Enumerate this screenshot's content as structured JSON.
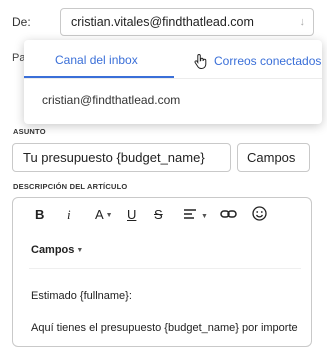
{
  "form": {
    "from_label": "De:",
    "from_value": "cristian.vitales@findthatlead.com",
    "hidden_label_fragment": "Pa"
  },
  "dropdown": {
    "tabs": [
      {
        "label": "Canal del inbox",
        "active": true
      },
      {
        "label": "Correos conectados",
        "active": false
      }
    ],
    "options": [
      "cristian@findthatlead.com"
    ]
  },
  "subject": {
    "label": "ASUNTO",
    "value": "Tu presupuesto {budget_name}",
    "fields_button": "Campos"
  },
  "description": {
    "label": "DESCRIPCIÓN DEL ARTÍCULO",
    "fields_dropdown": "Campos",
    "body_lines": [
      "Estimado {fullname}:",
      "Aquí tienes el presupuesto {budget_name} por importe"
    ]
  },
  "toolbar": {
    "bold": "B",
    "italic": "i",
    "font": "A",
    "underline": "U",
    "strikethrough": "S"
  },
  "colors": {
    "accent": "#3a6fd8",
    "border": "#c9c9c9"
  },
  "icons": [
    "chevron-down-icon",
    "hand-cursor-icon",
    "align-icon",
    "link-icon",
    "emoji-icon"
  ]
}
